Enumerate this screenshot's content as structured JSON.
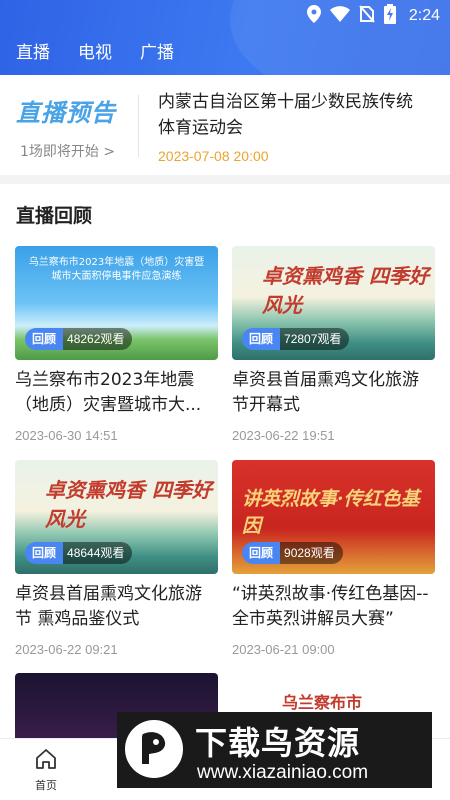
{
  "status_bar": {
    "time": "2:24"
  },
  "top_nav": {
    "tabs": [
      "直播",
      "电视",
      "广播"
    ]
  },
  "preview": {
    "logo_text": "直播预告",
    "sub_text": "1场即将开始 >",
    "title": "内蒙古自治区第十届少数民族传统体育运动会",
    "time": "2023-07-08 20:00"
  },
  "replay": {
    "section_title": "直播回顾",
    "badge_label": "回顾",
    "cards": [
      {
        "thumb_text": "乌兰察布市2023年地震（地质）灾害暨城市大面积停电事件应急演练",
        "views": "48262观看",
        "title": "乌兰察布市2023年地震（地质）灾害暨城市大...",
        "date": "2023-06-30 14:51"
      },
      {
        "thumb_text": "卓资熏鸡香 四季好风光",
        "views": "72807观看",
        "title": "卓资县首届熏鸡文化旅游节开幕式",
        "date": "2023-06-22 19:51"
      },
      {
        "thumb_text": "卓资熏鸡香 四季好风光",
        "views": "48644观看",
        "title": "卓资县首届熏鸡文化旅游节 熏鸡品鉴仪式",
        "date": "2023-06-22 09:21"
      },
      {
        "thumb_text": "讲英烈故事·传红色基因",
        "views": "9028观看",
        "title": "“讲英烈故事·传红色基因--全市英烈讲解员大赛”",
        "date": "2023-06-21 09:00"
      }
    ],
    "partial_card_text": "乌兰察布市"
  },
  "tab_bar": {
    "home_label": "首页"
  },
  "watermark": {
    "title": "下载鸟资源",
    "url": "www.xiazainiao.com"
  },
  "colors": {
    "header_blue": "#3a6fe9",
    "accent_orange": "#e9a52c",
    "badge_blue": "#4a86f2"
  }
}
